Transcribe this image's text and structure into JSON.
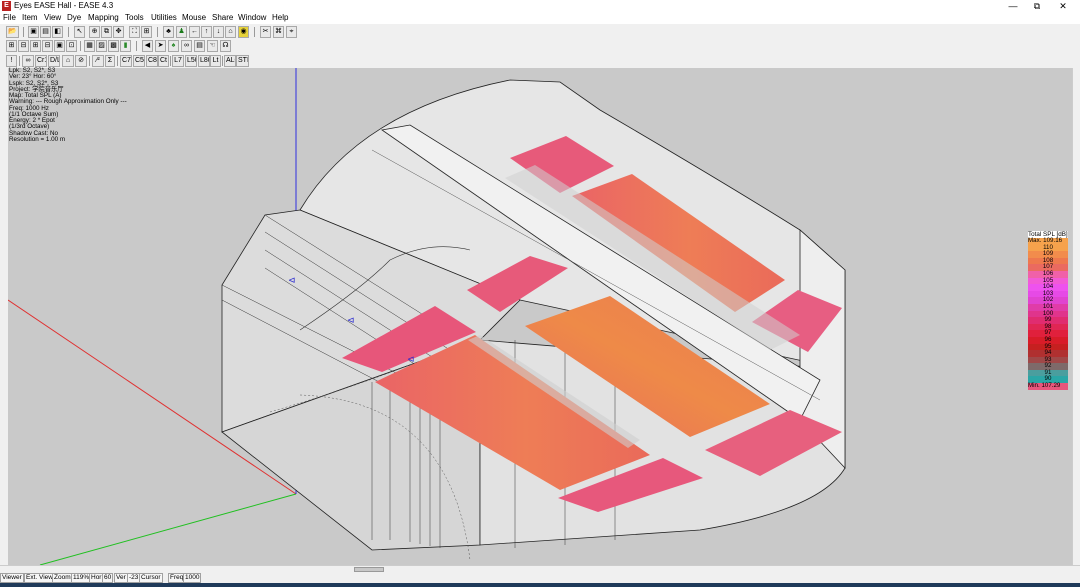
{
  "window": {
    "title": "Eyes EASE Hall - EASE 4.3",
    "app_icon": "ease-app-icon",
    "minimize_label": "—",
    "restore_label": "⧉",
    "close_label": "✕"
  },
  "menu": [
    "File",
    "Item",
    "View",
    "Dye",
    "Mapping",
    "Tools",
    "Utilities",
    "Mouse",
    "Share",
    "Window",
    "Help"
  ],
  "toolbar1": [
    "open-icon",
    "save-icon",
    "print-icon",
    "copy-icon",
    "pointer-icon",
    "move-icon",
    "pan-icon",
    "zoom-window-icon",
    "zoom-fit-icon",
    "grid-icon",
    "person-icon",
    "arrow-left-icon",
    "arrow-up-icon",
    "arrow-down-icon",
    "arrow-right-icon",
    "render-icon",
    "scissors-icon",
    "dye-icon",
    "pick-icon"
  ],
  "toolbar2": [
    "view-front-icon",
    "view-side-icon",
    "view-top-icon",
    "view-iso-icon",
    "view-box-icon",
    "view-persp-icon",
    "view-camera-icon",
    "shade-icon",
    "wire-icon",
    "bar-icon",
    "speaker-icon",
    "arrow-icon",
    "plant-icon",
    "link-icon",
    "photo-icon",
    "hand-icon",
    "ear-icon"
  ],
  "toolbar3": [
    "!",
    "∞",
    "Cr1",
    "D/L",
    "⌂",
    "⊘",
    "∕²",
    "Σ",
    "C7",
    "C50",
    "C80",
    "Ct",
    "L7",
    "L50",
    "L80",
    "Lt",
    "ALC",
    "STI"
  ],
  "info_lines": [
    "Lpk: S2, S2*, S3",
    "Ver: 23°  Hor: 60°",
    "Lspk: S2, S2*, S3",
    "Project: 学院音乐厅",
    "Map: Total SPL (A)",
    "Warning:  --- Rough Approximation Only ---",
    "Freq: 1000 Hz",
    "(1/1 Octave Sum)",
    "Energy: 2 * Epot",
    "(1/3rd Octave)",
    "Shadow Cast: No",
    "Resolution =  1.00 m"
  ],
  "legend": {
    "title": "Total SPL [dB]",
    "max_label": "Max.",
    "max_value": "109.16",
    "min_label": "Min.",
    "min_value": "107.29",
    "levels": [
      {
        "label": "110",
        "color": "#f6a24c"
      },
      {
        "label": "109",
        "color": "#f28c4c"
      },
      {
        "label": "108",
        "color": "#ee784e"
      },
      {
        "label": "107",
        "color": "#ea6a60"
      },
      {
        "label": "106",
        "color": "#f061a8"
      },
      {
        "label": "105",
        "color": "#f25ad6"
      },
      {
        "label": "104",
        "color": "#ee52ee"
      },
      {
        "label": "103",
        "color": "#e64ae6"
      },
      {
        "label": "102",
        "color": "#e044d0"
      },
      {
        "label": "101",
        "color": "#e03ca8"
      },
      {
        "label": "100",
        "color": "#e0348c"
      },
      {
        "label": "99",
        "color": "#e02c70"
      },
      {
        "label": "98",
        "color": "#e02654"
      },
      {
        "label": "97",
        "color": "#e0203c"
      },
      {
        "label": "96",
        "color": "#d81c28"
      },
      {
        "label": "95",
        "color": "#c62020"
      },
      {
        "label": "94",
        "color": "#b03030"
      },
      {
        "label": "93",
        "color": "#a04848"
      },
      {
        "label": "92",
        "color": "#7e6a6a"
      },
      {
        "label": "91",
        "color": "#4a9e9e"
      },
      {
        "label": "90",
        "color": "#2aa6a6"
      }
    ],
    "max_color": "#f6a24c",
    "min_color": "#e8567c"
  },
  "speaker_labels": [
    "S1",
    "S2",
    "S3"
  ],
  "status": [
    "Viewer",
    "Ext. View",
    "Zoom",
    "119%",
    "Hor",
    "60",
    "Ver",
    "-23",
    "Cursor",
    "Freq",
    "1000"
  ]
}
